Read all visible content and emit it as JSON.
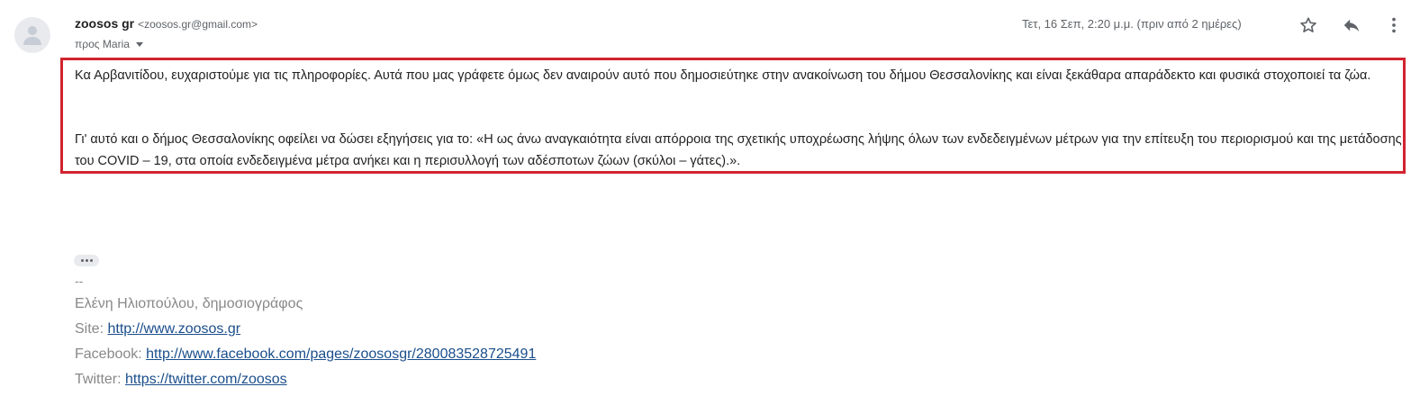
{
  "sender": {
    "name": "zoosos gr",
    "email": "<zoosos.gr@gmail.com>",
    "recipient": "προς Maria"
  },
  "date": "Τετ, 16 Σεπ, 2:20 μ.μ. (πριν από 2 ημέρες)",
  "toolbar": {
    "star_icon": "star-icon",
    "reply_icon": "reply-icon",
    "more_icon": "more-vert-icon"
  },
  "message": {
    "paragraph1": "Κα Αρβανιτίδου, ευχαριστούμε για τις πληροφορίες. Αυτά που μας γράφετε όμως δεν αναιρούν αυτό που δημοσιεύτηκε στην ανακοίνωση του δήμου Θεσσαλονίκης και είναι ξεκάθαρα απαράδεκτο και φυσικά στοχοποιεί τα ζώα.",
    "paragraph2": "Γι' αυτό και ο δήμος Θεσσαλονίκης οφείλει να δώσει εξηγήσεις για το: «Η ως άνω αναγκαιότητα είναι απόρροια της σχετικής υποχρέωσης λήψης όλων των ενδεδειγμένων μέτρων για την επίτευξη του περιορισμού και της μετάδοσης του COVID – 19, στα οποία ενδεδειγμένα μέτρα ανήκει και η περισυλλογή των αδέσποτων ζώων (σκύλοι – γάτες).».",
    "highlight_color": "#d1242f"
  },
  "signature": {
    "separator": "--",
    "name": "Ελένη Ηλιοπούλου, δημοσιογράφος",
    "site_label": "Site: ",
    "site_url": "http://www.zoosos.gr",
    "facebook_label": "Facebook: ",
    "facebook_url": "http://www.facebook.com/pages/zoososgr/280083528725491",
    "twitter_label": "Twitter: ",
    "twitter_url": "https://twitter.com/zoosos"
  }
}
